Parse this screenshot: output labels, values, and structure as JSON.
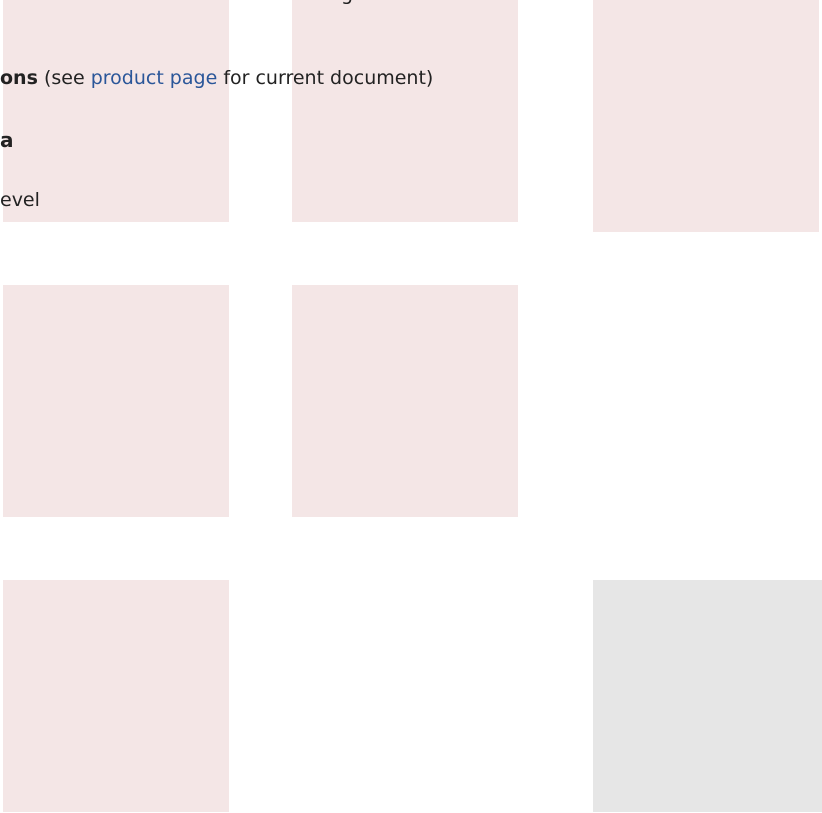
{
  "top_fragment": "g",
  "specs_line": {
    "bold": "ons",
    "before_link": "(see",
    "link": "product page",
    "after_link": "for current document)"
  },
  "heading_fragment": "a",
  "level_fragment": "evel",
  "colors": {
    "tile": "#f4e6e6",
    "tile_placeholder": "#e6e6e6",
    "link": "#2a5699"
  }
}
